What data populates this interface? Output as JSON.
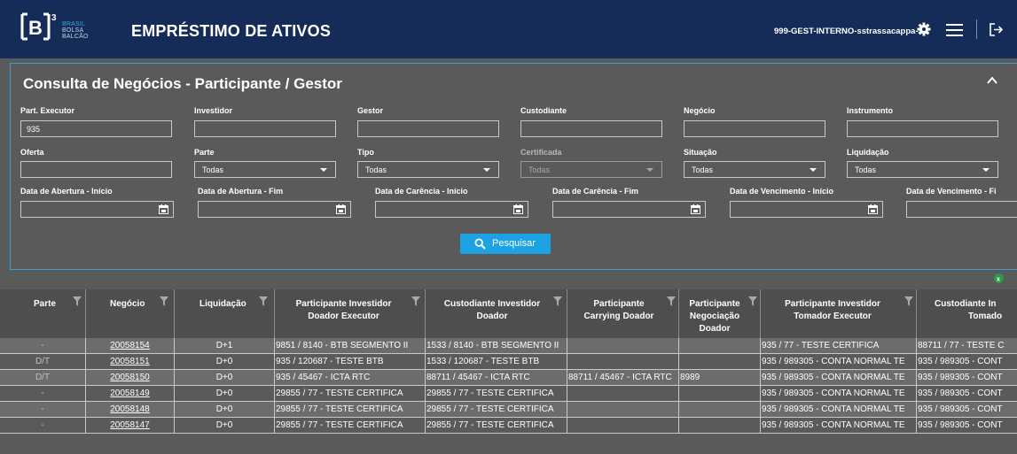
{
  "header": {
    "logo_lines": [
      "BRASIL",
      "BOLSA",
      "BALCÃO"
    ],
    "app_title": "EMPRÉSTIMO DE ATIVOS",
    "user": "999-GEST-INTERNO-sstrassacappa-S1",
    "icons": [
      "gear-icon",
      "menu-icon",
      "logout-icon"
    ]
  },
  "panel": {
    "title": "Consulta de Negócios - Participante / Gestor",
    "fields": {
      "part_executor": {
        "label": "Part. Executor",
        "value": "935"
      },
      "investidor": {
        "label": "Investidor",
        "value": ""
      },
      "gestor": {
        "label": "Gestor",
        "value": ""
      },
      "custodiante": {
        "label": "Custodiante",
        "value": ""
      },
      "negocio": {
        "label": "Negócio",
        "value": ""
      },
      "instrumento": {
        "label": "Instrumento",
        "value": ""
      },
      "oferta": {
        "label": "Oferta",
        "value": ""
      },
      "parte": {
        "label": "Parte",
        "value": "Todas"
      },
      "tipo": {
        "label": "Tipo",
        "value": "Todas"
      },
      "certificada": {
        "label": "Certificada",
        "value": "Todas"
      },
      "situacao": {
        "label": "Situação",
        "value": "Todas"
      },
      "liquidacao": {
        "label": "Liquidação",
        "value": "Todas"
      },
      "abertura_inicio": {
        "label": "Data de Abertura - Início"
      },
      "abertura_fim": {
        "label": "Data de Abertura - Fim"
      },
      "carencia_inicio": {
        "label": "Data de Carência - Início"
      },
      "carencia_fim": {
        "label": "Data de Carência - Fim"
      },
      "vencimento_inicio": {
        "label": "Data de Vencimento - Início"
      },
      "vencimento_fim": {
        "label": "Data de Vencimento - Fi"
      }
    },
    "search_label": "Pesquisar"
  },
  "table": {
    "headers": {
      "parte": "Parte",
      "negocio": "Negócio",
      "liquidacao": "Liquidação",
      "pi_doador_1": "Participante Investidor",
      "pi_doador_2": "Doador Executor",
      "ci_doador_1": "Custodiante Investidor",
      "ci_doador_2": "Doador",
      "pc_doador_1": "Participante",
      "pc_doador_2": "Carrying Doador",
      "pn_doador_1": "Participante",
      "pn_doador_2": "Negociação",
      "pn_doador_3": "Doador",
      "pi_tomador_1": "Participante Investidor",
      "pi_tomador_2": "Tomador Executor",
      "ci_tomador_1": "Custodiante In",
      "ci_tomador_2": "Tomado"
    },
    "rows": [
      {
        "parte": "-",
        "negocio": "20058154",
        "liquidacao": "D+1",
        "pi_doador": "9851 / 8140 - BTB SEGMENTO II",
        "ci_doador": "1533 / 8140 - BTB SEGMENTO II",
        "pc_doador": "",
        "pn_doador": "",
        "pi_tomador": "935 / 77 - TESTE CERTIFICA",
        "ci_tomador": "88711 / 77 - TESTE C"
      },
      {
        "parte": "D/T",
        "negocio": "20058151",
        "liquidacao": "D+0",
        "pi_doador": "935 / 120687 - TESTE BTB",
        "ci_doador": "1533 / 120687 - TESTE BTB",
        "pc_doador": "",
        "pn_doador": "",
        "pi_tomador": "935 / 989305 - CONTA NORMAL TE",
        "ci_tomador": "935 / 989305 - CONT"
      },
      {
        "parte": "D/T",
        "negocio": "20058150",
        "liquidacao": "D+0",
        "pi_doador": "935 / 45467 - ICTA RTC",
        "ci_doador": "88711 / 45467 - ICTA RTC",
        "pc_doador": "88711 / 45467 - ICTA RTC",
        "pn_doador": "8989",
        "pi_tomador": "935 / 989305 - CONTA NORMAL TE",
        "ci_tomador": "935 / 989305 - CONT"
      },
      {
        "parte": "-",
        "negocio": "20058149",
        "liquidacao": "D+0",
        "pi_doador": "29855 / 77 - TESTE CERTIFICA",
        "ci_doador": "29855 / 77 - TESTE CERTIFICA",
        "pc_doador": "",
        "pn_doador": "",
        "pi_tomador": "935 / 989305 - CONTA NORMAL TE",
        "ci_tomador": "935 / 989305 - CONT"
      },
      {
        "parte": "-",
        "negocio": "20058148",
        "liquidacao": "D+0",
        "pi_doador": "29855 / 77 - TESTE CERTIFICA",
        "ci_doador": "29855 / 77 - TESTE CERTIFICA",
        "pc_doador": "",
        "pn_doador": "",
        "pi_tomador": "935 / 989305 - CONTA NORMAL TE",
        "ci_tomador": "935 / 989305 - CONT"
      },
      {
        "parte": "-",
        "negocio": "20058147",
        "liquidacao": "D+0",
        "pi_doador": "29855 / 77 - TESTE CERTIFICA",
        "ci_doador": "29855 / 77 - TESTE CERTIFICA",
        "pc_doador": "",
        "pn_doador": "",
        "pi_tomador": "935 / 989305 - CONTA NORMAL TE",
        "ci_tomador": "935 / 989305 - CONT"
      }
    ]
  }
}
